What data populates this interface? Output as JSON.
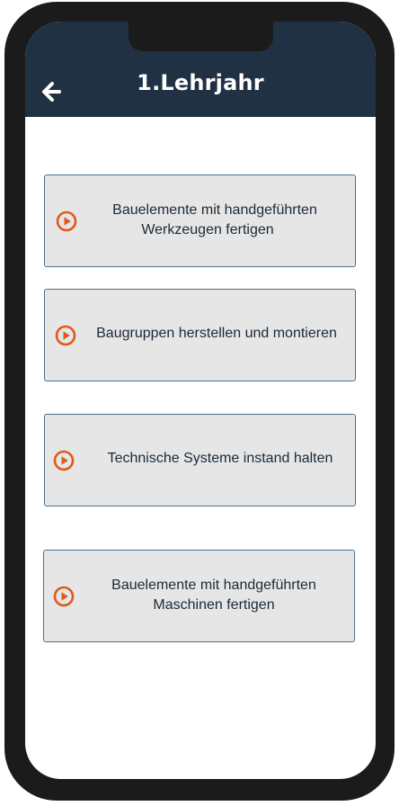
{
  "header": {
    "title": "1.Lehrjahr",
    "back_icon": "arrow-left-icon",
    "background": "#1f3142"
  },
  "modules": [
    {
      "line1": "Bauelemente mit handgeführten",
      "line2": "Werkzeugen fertigen",
      "icon": "play-circle-icon"
    },
    {
      "line1": "Baugruppen herstellen und montieren",
      "line2": "",
      "icon": "play-circle-icon"
    },
    {
      "line1": "Technische Systeme instand halten",
      "line2": "",
      "icon": "play-circle-icon"
    },
    {
      "line1": "Bauelemente mit handgeführten",
      "line2": "Maschinen fertigen",
      "icon": "play-circle-icon"
    }
  ],
  "colors": {
    "accent": "#e05a1a",
    "card_bg": "#e6e6e6",
    "card_border": "#4f6d8c"
  }
}
